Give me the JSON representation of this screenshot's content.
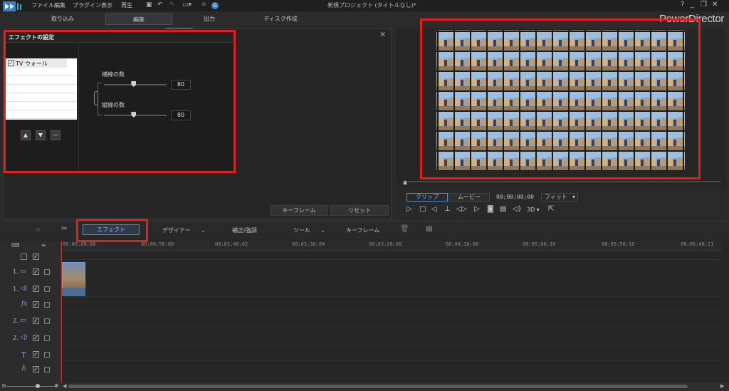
{
  "menu": [
    "ファイル",
    "編集",
    "プラグイン",
    "表示",
    "再生"
  ],
  "doc_title": "新規プロジェクト (タイトルなし)*",
  "brand": "PowerDirector",
  "window_controls": [
    "?",
    "_",
    "❐",
    "✕"
  ],
  "modes": [
    "取り込み",
    "編集",
    "出力",
    "ディスク作成"
  ],
  "dialog": {
    "title": "エフェクトの設定",
    "effect_item": "TV ウォール",
    "param1_label": "横線の数",
    "param1_value": "80",
    "param2_label": "縦線の数",
    "param2_value": "80",
    "param1_level": 0.47,
    "param2_level": 0.47
  },
  "panel_buttons": {
    "keyframe": "キーフレーム",
    "reset": "リセット"
  },
  "preview": {
    "clip_tab": "クリップ",
    "movie_tab": "ムービー",
    "timecode": "00;00;00;00",
    "fit": "フィット",
    "three_d": "3D"
  },
  "timeline_toolbar": {
    "effect": "エフェクト",
    "designer": "デザイナー",
    "fix": "補正/強調",
    "tools": "ツール",
    "keyframe": "キーフレーム"
  },
  "ruler": [
    "00;00;00;00",
    "00;00;50;00",
    "00;01;40;02",
    "00;02;30;04",
    "00;03;20;06",
    "00;04;10;08",
    "00;05;00;10",
    "00;05;50;10",
    "00;06;40;11"
  ],
  "tracks": [
    {
      "num": "1.",
      "icon": "video-icon"
    },
    {
      "num": "1.",
      "icon": "audio-icon"
    },
    {
      "num": "",
      "icon": "fx-icon"
    },
    {
      "num": "2.",
      "icon": "video-icon"
    },
    {
      "num": "2.",
      "icon": "audio-icon"
    },
    {
      "num": "",
      "icon": "title-icon"
    },
    {
      "num": "",
      "icon": "voice-icon"
    }
  ],
  "colors": {
    "annotation": "#e41d1d",
    "accent": "#4a8fd9"
  }
}
